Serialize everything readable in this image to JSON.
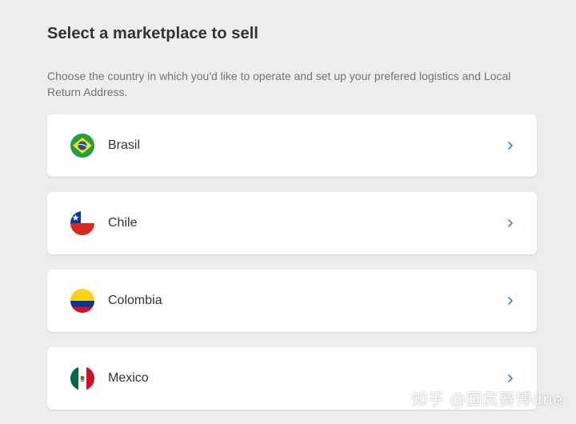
{
  "header": {
    "title": "Select a marketplace to sell",
    "description": "Choose the country in which you'd like to operate and set up your prefered logistics and Local Return Address."
  },
  "countries": [
    {
      "label": "Brasil",
      "flag_icon": "brazil-flag-icon"
    },
    {
      "label": "Chile",
      "flag_icon": "chile-flag-icon"
    },
    {
      "label": "Colombia",
      "flag_icon": "colombia-flag-icon"
    },
    {
      "label": "Mexico",
      "flag_icon": "mexico-flag-icon"
    }
  ],
  "watermark": "知乎 @国民赛博dne",
  "colors": {
    "background": "#ededed",
    "card": "#ffffff",
    "chevron": "#3483fa",
    "title_text": "#333333",
    "description_text": "#737373"
  }
}
